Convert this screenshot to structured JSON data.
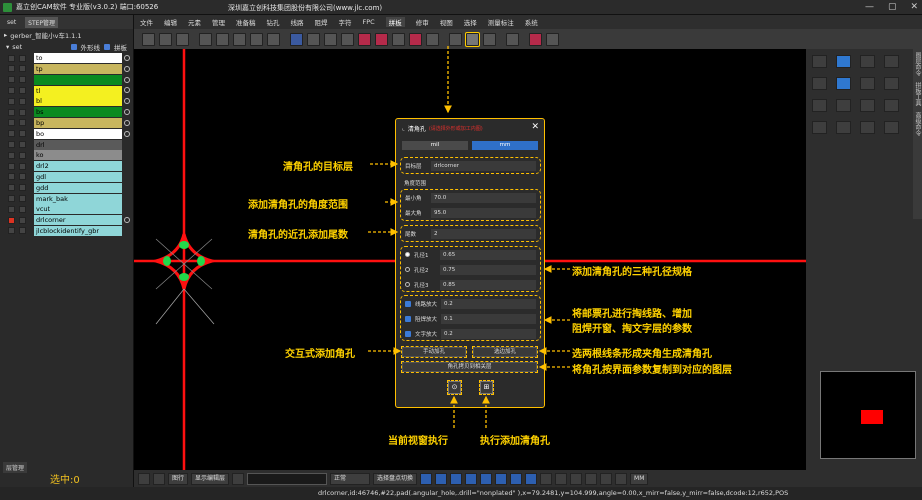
{
  "app": {
    "title": "嘉立创CAM软件 专业版(v3.0.2) 端口:60526",
    "company": "深圳嘉立创科技集团股份有限公司(www.jlc.com)"
  },
  "left_panel": {
    "tabs": [
      "set",
      "STEP管理"
    ],
    "tree_root": "gerber_智能小v车1.1.1",
    "set_label": "set",
    "opt_outline": "外形线",
    "opt_panel": "拼板",
    "layers": [
      {
        "name": "to",
        "color": "#ffffff"
      },
      {
        "name": "tp",
        "color": "#c8b65e"
      },
      {
        "name": "",
        "color": "#0a8a20"
      },
      {
        "name": "tl",
        "color": "#f4f020"
      },
      {
        "name": "bl",
        "color": "#f4f020"
      },
      {
        "name": "bs",
        "color": "#0a8a20"
      },
      {
        "name": "bp",
        "color": "#c8b65e"
      },
      {
        "name": "bo",
        "color": "#ffffff"
      },
      {
        "name": "drl",
        "color": "#5a5a5a"
      },
      {
        "name": "ko",
        "color": "#8c8c8c"
      },
      {
        "name": "drl2",
        "color": "#8fd6d8"
      },
      {
        "name": "gdl",
        "color": "#8fd6d8"
      },
      {
        "name": "gdd",
        "color": "#8fd6d8"
      },
      {
        "name": "mark_bak",
        "color": "#8fd6d8"
      },
      {
        "name": "vcut",
        "color": "#8fd6d8"
      },
      {
        "name": "drlcorner",
        "color": "#8fd6d8"
      },
      {
        "name": "jlcblockidentify_gbr",
        "color": "#8fd6d8"
      }
    ],
    "bottom_tab": "层管理",
    "selected": "选中:0"
  },
  "menu": [
    "文件",
    "编辑",
    "元素",
    "管理",
    "准备稿",
    "钻孔",
    "线路",
    "阻焊",
    "字符",
    "FPC",
    "拼板",
    "修审",
    "视图",
    "选择",
    "测量标注",
    "系统"
  ],
  "menu_active": "拼板",
  "dialog": {
    "title": "清角孔",
    "hint": "(请选择外形或加工内图)",
    "close": "✕",
    "unit_mil": "mil",
    "unit_mm": "mm",
    "target_label": "目标层",
    "target_value": "drlcorner",
    "angle_title": "角度范围",
    "min_label": "最小角",
    "min_value": "70.0",
    "max_label": "最大角",
    "max_value": "95.0",
    "tail_label": "尾数",
    "tail_value": "2",
    "hole1_label": "孔径1",
    "hole1_value": "0.65",
    "hole2_label": "孔径2",
    "hole2_value": "0.75",
    "hole3_label": "孔径3",
    "hole3_value": "0.85",
    "route_label": "线路放大",
    "route_value": "0.2",
    "mask_label": "阻焊放大",
    "mask_value": "0.1",
    "text_label": "文字放大",
    "text_value": "0.2",
    "manual_btn": "手动加孔",
    "select_btn": "选边加孔",
    "copy_btn": "角孔拷贝到相关层",
    "exec_view": "⊙",
    "exec_add": "⊞"
  },
  "annotations": {
    "target_layer": "清角孔的目标层",
    "angle_range": "添加清角孔的角度范围",
    "tail": "清角孔的近孔添加尾数",
    "three_specs": "添加清角孔的三种孔径规格",
    "enlarge_line1": "将邮票孔进行掏线路、增加",
    "enlarge_line2": "阻焊开窗、掏文字层的参数",
    "interactive": "交互式添加角孔",
    "two_lines": "选两根线条形成夹角生成清角孔",
    "copy_layer": "将角孔按界面参数复制到对应的图层",
    "exec_view": "当前视窗执行",
    "exec_add": "执行添加清角孔"
  },
  "right_panel": {
    "vtabs": [
      "图层命令",
      "拼板工具",
      "高级命令"
    ]
  },
  "bottom": {
    "btn1": "图行",
    "btn2": "显示编辑层",
    "mode": "正常",
    "btn3": "选择盘点切换",
    "unit": "MM"
  },
  "status": "drlcorner,id:46746,#22,pad(.angular_hole,.drill=\"nonplated\" ),x=79.2481,y=104.999,angle=0.00,x_mirr=false,y_mirr=false,dcode:12,r652,POS"
}
